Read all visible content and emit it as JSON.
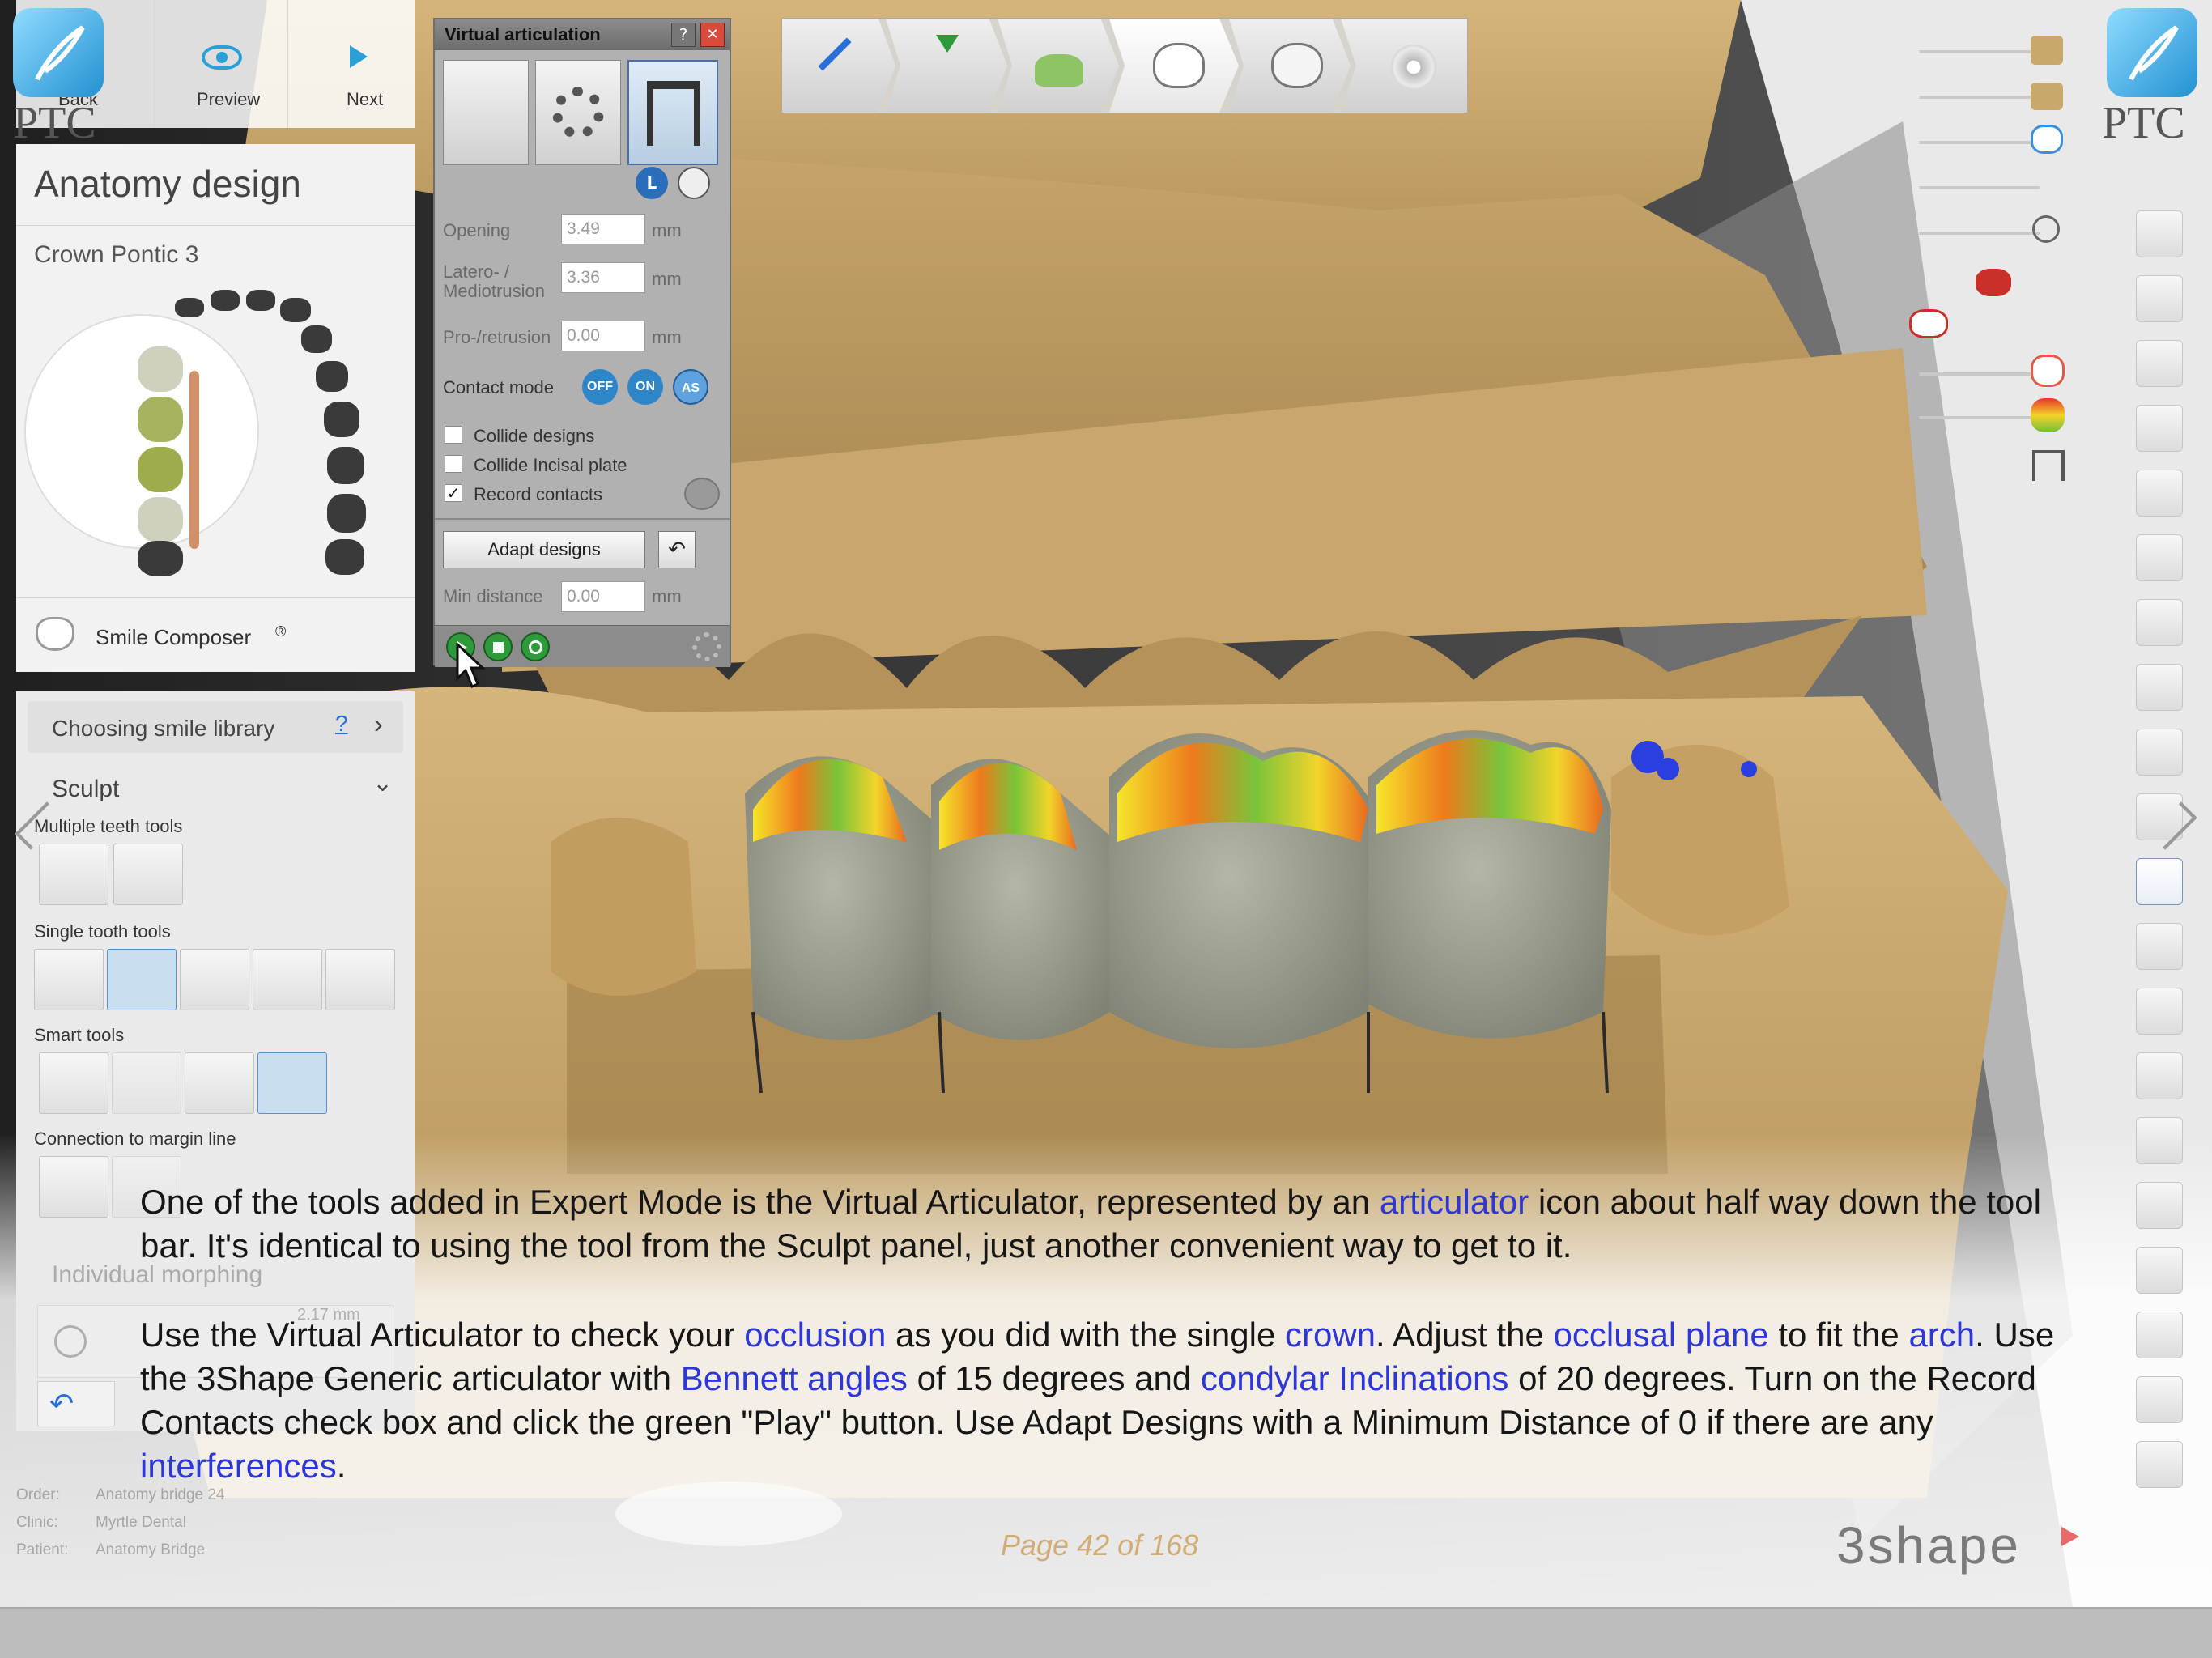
{
  "nav": {
    "back_label": "Back",
    "preview_label": "Preview",
    "next_label": "Next",
    "brand_text": "PTC"
  },
  "left_panel": {
    "title": "Anatomy design",
    "subtitle": "Crown Pontic 3",
    "smile_composer_label": "Smile Composer",
    "smile_composer_mark": "®",
    "library_label": "Choosing smile library",
    "library_help": "?",
    "sculpt_label": "Sculpt",
    "multi_tools_label": "Multiple teeth tools",
    "single_tools_label": "Single tooth tools",
    "smart_tools_label": "Smart tools",
    "margin_label": "Connection to margin line",
    "morph_label": "Individual morphing",
    "morph_value": "2.17 mm"
  },
  "footer_info": {
    "order_label": "Order:",
    "order_value": "Anatomy bridge 24",
    "client_label": "Clinic:",
    "client_value": "Myrtle Dental",
    "patient_label": "Patient:",
    "patient_value": "Anatomy Bridge"
  },
  "va_panel": {
    "title": "Virtual articulation",
    "help": "?",
    "close": "✕",
    "opening_label": "Opening",
    "opening_value": "3.49",
    "latero_label": "Latero- / Mediotrusion",
    "latero_value": "3.36",
    "pro_label": "Pro-/retrusion",
    "pro_value": "0.00",
    "unit": "mm",
    "contact_mode_label": "Contact mode",
    "mode_off": "OFF",
    "mode_on": "ON",
    "mode_as": "AS",
    "collide_designs_label": "Collide designs",
    "collide_designs_checked": false,
    "collide_incisal_label": "Collide Incisal plate",
    "collide_incisal_checked": false,
    "record_contacts_label": "Record contacts",
    "record_contacts_checked": true,
    "adapt_button": "Adapt designs",
    "min_distance_label": "Min distance",
    "min_distance_value": "0.00",
    "lock_letter": "L"
  },
  "overlay": {
    "p1": [
      {
        "t": "One of the tools added in Expert Mode is the Virtual Articulator, represented by an ",
        "link": false
      },
      {
        "t": "articulator",
        "link": true
      },
      {
        "t": " icon about half way down the tool bar.  It's identical to using the tool from the Sculpt panel, just another convenient way to get to it.",
        "link": false
      }
    ],
    "p2": [
      {
        "t": "Use the Virtual Articulator to check your ",
        "link": false
      },
      {
        "t": "occlusion",
        "link": true
      },
      {
        "t": " as you did with the single ",
        "link": false
      },
      {
        "t": "crown",
        "link": true
      },
      {
        "t": ".  Adjust the ",
        "link": false
      },
      {
        "t": "occlusal plane",
        "link": true
      },
      {
        "t": " to fit the ",
        "link": false
      },
      {
        "t": "arch",
        "link": true
      },
      {
        "t": ".  Use the 3Shape Generic articulator with ",
        "link": false
      },
      {
        "t": "Bennett angles",
        "link": true
      },
      {
        "t": " of 15 degrees and ",
        "link": false
      },
      {
        "t": "condylar Inclinations",
        "link": true
      },
      {
        "t": " of 20 degrees.  Turn on the Record Contacts check box and click the green \"Play\" button.  Use Adapt Designs with a Minimum Distance of 0 if there are any ",
        "link": false
      },
      {
        "t": "interferences",
        "link": true
      },
      {
        "t": ".",
        "link": false
      }
    ],
    "page_indicator": "Page 42 of 168",
    "brand": "3shape"
  },
  "icons": {
    "back": "back-arrow-icon",
    "preview": "eye-icon",
    "next": "next-arrow-icon",
    "settings": "gear-icon",
    "play": "play-icon",
    "stop": "stop-icon",
    "reset": "reset-icon",
    "undo": "undo-icon",
    "page_prev": "chevron-left-icon",
    "page_next": "chevron-right-icon"
  },
  "colors": {
    "link": "#2d36d6",
    "model_gypsum": "#c9a86c",
    "tooth_gray": "#9a9d8e",
    "panel_bg": "#eeeeee",
    "va_bg": "#b0b0b0",
    "page_indicator": "#c4852a",
    "nav_blue": "#2a9fd8"
  }
}
